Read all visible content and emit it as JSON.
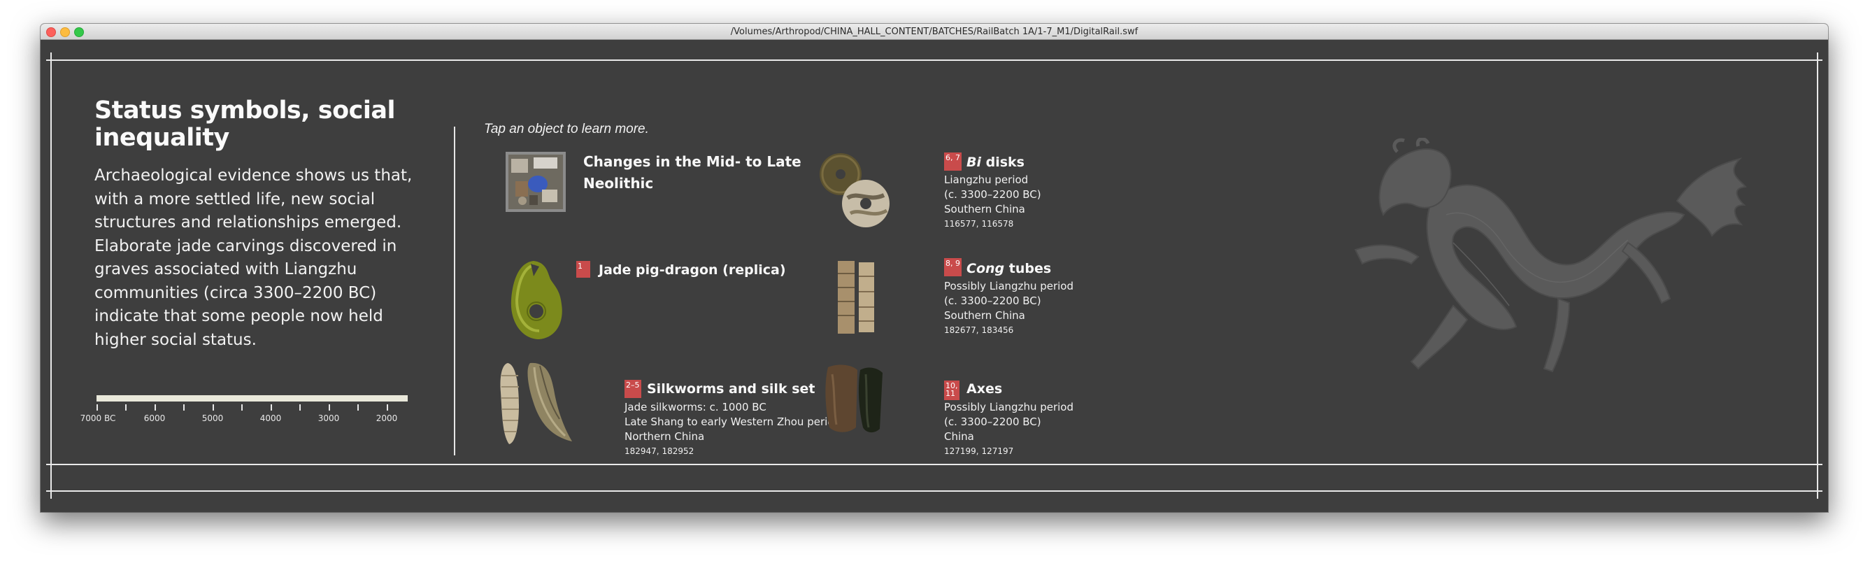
{
  "window": {
    "title": "/Volumes/Arthropod/CHINA_HALL_CONTENT/BATCHES/RailBatch 1A/1-7_M1/DigitalRail.swf"
  },
  "section": {
    "heading": "Status symbols, social inequality",
    "intro": "Archaeological evidence shows us that, with a more settled life, new social structures and relationships emerged. Elaborate jade carvings discovered in graves associated with Liangzhu communities (circa 3300–2200 BC) indicate that some people now held higher social status."
  },
  "timeline": {
    "labels": [
      "7000 BC",
      "6000",
      "5000",
      "4000",
      "3000",
      "2000"
    ]
  },
  "hint": "Tap an object to learn more.",
  "objects": {
    "neolithic": {
      "title_line1": "Changes in the Mid- to Late",
      "title_line2": "Neolithic"
    },
    "pig_dragon": {
      "badge": "1",
      "title": "Jade pig-dragon (replica)"
    },
    "silkworms": {
      "badge_line1": "2–5",
      "title": "Silkworms and silk set",
      "line1": "Jade silkworms: c. 1000 BC",
      "line2": "Late Shang to early Western Zhou period",
      "line3": "Northern China",
      "numbers": "182947, 182952"
    },
    "bi_disks": {
      "badge_line1": "6, 7",
      "title_italic": "Bi",
      "title_rest": " disks",
      "line1": "Liangzhu period",
      "line2": "(c. 3300–2200 BC)",
      "line3": "Southern China",
      "numbers": "116577, 116578"
    },
    "cong_tubes": {
      "badge_line1": "8, 9",
      "title_italic": "Cong",
      "title_rest": " tubes",
      "line1": "Possibly Liangzhu period",
      "line2": "(c. 3300–2200 BC)",
      "line3": "Southern China",
      "numbers": "182677, 183456"
    },
    "axes": {
      "badge_line1": "10,",
      "badge_line2": "11",
      "title": "Axes",
      "line1": "Possibly Liangzhu period",
      "line2": "(c. 3300–2200 BC)",
      "line3": "China",
      "numbers": "127199, 127197"
    }
  },
  "colors": {
    "background": "#3e3e3e",
    "badge": "#c94b4b",
    "frame": "#e9e9e9",
    "dragon": "#5a5a5a"
  }
}
